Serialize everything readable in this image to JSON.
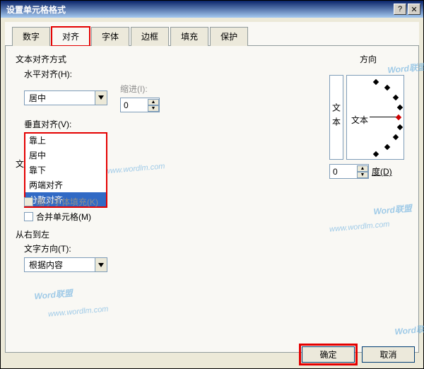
{
  "window": {
    "title": "设置单元格格式"
  },
  "tabs": [
    "数字",
    "对齐",
    "字体",
    "边框",
    "填充",
    "保护"
  ],
  "active_tab_index": 1,
  "panel": {
    "text_alignment_label": "文本对齐方式",
    "h_align": {
      "label": "水平对齐(H):",
      "value": "居中"
    },
    "indent": {
      "label": "缩进(I):",
      "value": "0"
    },
    "v_align": {
      "label": "垂直对齐(V):",
      "value": "居中"
    },
    "v_options": [
      "靠上",
      "居中",
      "靠下",
      "两端对齐",
      "分散对齐"
    ],
    "v_selected_option": "分散对齐",
    "text_control_label": "文",
    "cb_shrink": "缩小字体填充(K)",
    "cb_merge": "合并单元格(M)",
    "rtl_label": "从右到左",
    "text_direction": {
      "label": "文字方向(T):",
      "value": "根据内容"
    }
  },
  "orientation": {
    "label": "方向",
    "vert_text": "文本",
    "arc_text": "文本",
    "degree_value": "0",
    "degree_label": "度(D)"
  },
  "buttons": {
    "ok": "确定",
    "cancel": "取消"
  },
  "watermark": {
    "brand": "Word联盟",
    "url": "www.wordlm.com"
  }
}
